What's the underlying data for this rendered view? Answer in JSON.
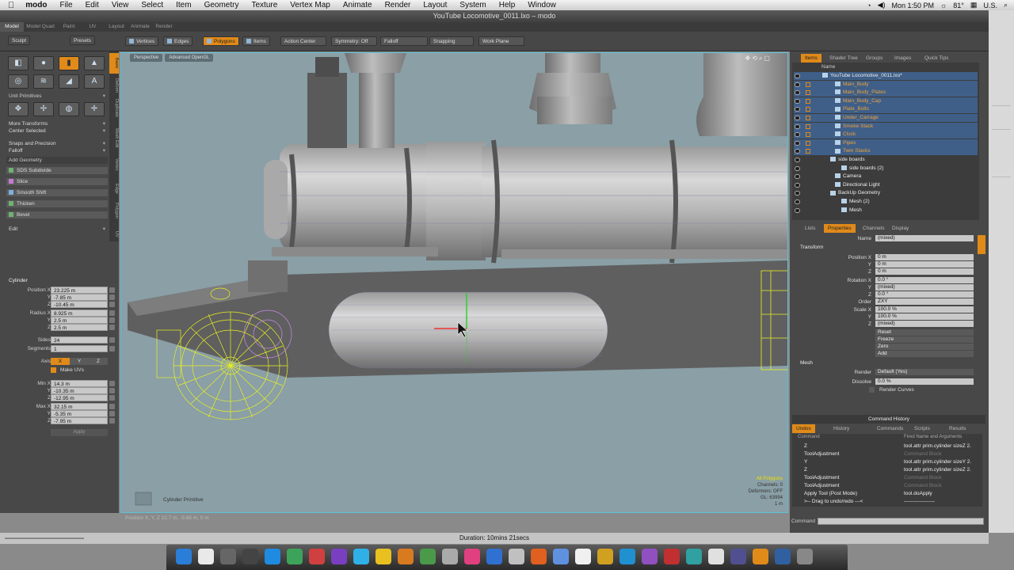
{
  "menubar": {
    "app": "modo",
    "items": [
      "File",
      "Edit",
      "View",
      "Select",
      "Item",
      "Geometry",
      "Texture",
      "Vertex Map",
      "Animate",
      "Render",
      "Layout",
      "System",
      "Help",
      "Window"
    ],
    "clock": "Mon 1:50 PM",
    "temp": "81°",
    "locale": "U.S."
  },
  "window": {
    "title": "YouTube Locomotive_0011.lxo – modo"
  },
  "layout_tabs": [
    "Model",
    "Model Quad",
    "Paint",
    "UV",
    "Layout",
    "Animate",
    "Render"
  ],
  "toolbar": {
    "sculpt": "Sculpt",
    "presets": "Presets",
    "vertices": "Vertices",
    "edges": "Edges",
    "polygons": "Polygons",
    "items": "Items",
    "action_center": "Action Center",
    "symmetry": "Symmetry: Off",
    "falloff": "Falloff",
    "snapping": "Snapping",
    "work_plane": "Work Plane"
  },
  "left": {
    "vtabs": [
      "Basic",
      "Deform",
      "Duplicate",
      "Mesh Edit",
      "Vertex",
      "Edge",
      "Polygon",
      "UV"
    ],
    "unit_primitives": "Unit Primitives",
    "more_transforms": "More Transforms",
    "center_selected": "Center Selected",
    "snaps_precision": "Snaps and Precision",
    "falloff": "Falloff",
    "add_geometry": "Add Geometry",
    "geom_items": [
      "SDS Subdivide",
      "Slice",
      "Smooth Shift",
      "Thicken",
      "Bevel"
    ],
    "edit": "Edit",
    "cylinder_title": "Cylinder",
    "cyl": [
      {
        "label": "Position X",
        "value": "23.225 m"
      },
      {
        "label": "Y",
        "value": "-7.85 m"
      },
      {
        "label": "Z",
        "value": "-10.45 m"
      },
      {
        "label": "Radius X",
        "value": "8.925 m"
      },
      {
        "label": "Y",
        "value": "2.5 m"
      },
      {
        "label": "Z",
        "value": "2.5 m"
      },
      {
        "label": "Sides",
        "value": "24"
      },
      {
        "label": "Segments",
        "value": "1"
      }
    ],
    "axis_label": "Axis",
    "axis": [
      "X",
      "Y",
      "Z"
    ],
    "make_uvs": "Make UVs",
    "minmax": [
      {
        "label": "Min X",
        "value": "14.3 m"
      },
      {
        "label": "Y",
        "value": "-10.35 m"
      },
      {
        "label": "Z",
        "value": "-12.95 m"
      },
      {
        "label": "Max X",
        "value": "32.15 m"
      },
      {
        "label": "Y",
        "value": "-5.35 m"
      },
      {
        "label": "Z",
        "value": "-7.95 m"
      }
    ],
    "apply": "Apply"
  },
  "viewport": {
    "tab_perspective": "Perspective",
    "tab_gl": "Advanced OpenGL",
    "tool_name": "Cylinder Primitive",
    "info": [
      "All Polygons",
      "Channels: 0",
      "Deformers: OFF",
      "GL: 63994",
      "1 m"
    ]
  },
  "status": {
    "position": "Position X, Y, Z   22.7 m, -9.85 m, 0 m",
    "duration": "Duration: 10mins 21secs"
  },
  "items_panel": {
    "tabs": [
      "Items",
      "Shader Tree",
      "Groups",
      "Images",
      "Quick Tips"
    ],
    "name_header": "Name",
    "rows": [
      {
        "label": "YouTube Locomotive_0011.lxo*",
        "orange": false,
        "sel": true,
        "indent": 36
      },
      {
        "label": "Main_Body",
        "orange": true,
        "sel": true,
        "indent": 52
      },
      {
        "label": "Main_Body_Plates",
        "orange": true,
        "sel": true,
        "indent": 52
      },
      {
        "label": "Main_Body_Cap",
        "orange": true,
        "sel": true,
        "indent": 52
      },
      {
        "label": "Plate_Bolts",
        "orange": true,
        "sel": true,
        "indent": 52
      },
      {
        "label": "Under_Carrage",
        "orange": true,
        "sel": true,
        "indent": 52
      },
      {
        "label": "Smoke Stack",
        "orange": true,
        "sel": true,
        "indent": 52
      },
      {
        "label": "Clock",
        "orange": true,
        "sel": true,
        "indent": 52
      },
      {
        "label": "Pipes",
        "orange": true,
        "sel": true,
        "indent": 52
      },
      {
        "label": "Twin Stacks",
        "orange": true,
        "sel": true,
        "indent": 52
      },
      {
        "label": "side boards",
        "orange": false,
        "sel": false,
        "indent": 46
      },
      {
        "label": "side boards (2)",
        "orange": false,
        "sel": false,
        "indent": 60
      },
      {
        "label": "Camera",
        "orange": false,
        "sel": false,
        "indent": 52
      },
      {
        "label": "Directional Light",
        "orange": false,
        "sel": false,
        "indent": 52
      },
      {
        "label": "BackUp Geometry",
        "orange": false,
        "sel": false,
        "indent": 46
      },
      {
        "label": "Mesh (2)",
        "orange": false,
        "sel": false,
        "indent": 60
      },
      {
        "label": "Mesh",
        "orange": false,
        "sel": false,
        "indent": 60
      }
    ]
  },
  "props": {
    "tabs": [
      "Lists",
      "Properties",
      "Channels",
      "Display"
    ],
    "name_label": "Name",
    "name_value": "(mixed)",
    "transform_hdr": "Transform",
    "rows": [
      {
        "label": "Position X",
        "value": "0 m"
      },
      {
        "label": "Y",
        "value": "0 m"
      },
      {
        "label": "Z",
        "value": "0 m"
      },
      {
        "label": "Rotation X",
        "value": "0.0 °"
      },
      {
        "label": "Y",
        "value": "(mixed)"
      },
      {
        "label": "Z",
        "value": "0.0 °"
      },
      {
        "label": "Order",
        "value": "ZXY"
      },
      {
        "label": "Scale X",
        "value": "100.0 %"
      },
      {
        "label": "Y",
        "value": "100.0 %"
      },
      {
        "label": "Z",
        "value": "(mixed)"
      }
    ],
    "actions": [
      "Reset",
      "Freeze",
      "Zero",
      "Add"
    ],
    "mesh_hdr": "Mesh",
    "render_label": "Render",
    "render_value": "Default (Yes)",
    "dissolve_label": "Dissolve",
    "dissolve_value": "0.0 %",
    "render_curves": "Render Curves"
  },
  "history": {
    "title": "Command History",
    "tabs": [
      "Undos",
      "History",
      "Commands",
      "Scripts",
      "Results"
    ],
    "col1": "Command",
    "col2": "Fired Name and Arguments",
    "rows": [
      {
        "cmd": "Z",
        "args": "tool.attr prim.cylinder sizeZ 2.",
        "dim": false
      },
      {
        "cmd": "ToolAdjustment",
        "args": "Command Block",
        "dim": true
      },
      {
        "cmd": "Y",
        "args": "tool.attr prim.cylinder sizeY 2.",
        "dim": false
      },
      {
        "cmd": "Z",
        "args": "tool.attr prim.cylinder sizeZ 2.",
        "dim": false
      },
      {
        "cmd": "ToolAdjustment",
        "args": "Command Block",
        "dim": true
      },
      {
        "cmd": "ToolAdjustment",
        "args": "Command Block",
        "dim": true
      },
      {
        "cmd": "Apply Tool (Post Mode)",
        "args": "tool.doApply",
        "dim": false
      },
      {
        "cmd": ">-- Drag to undo/redo ---<",
        "args": "------------------",
        "dim": false
      }
    ],
    "command_label": "Command"
  }
}
